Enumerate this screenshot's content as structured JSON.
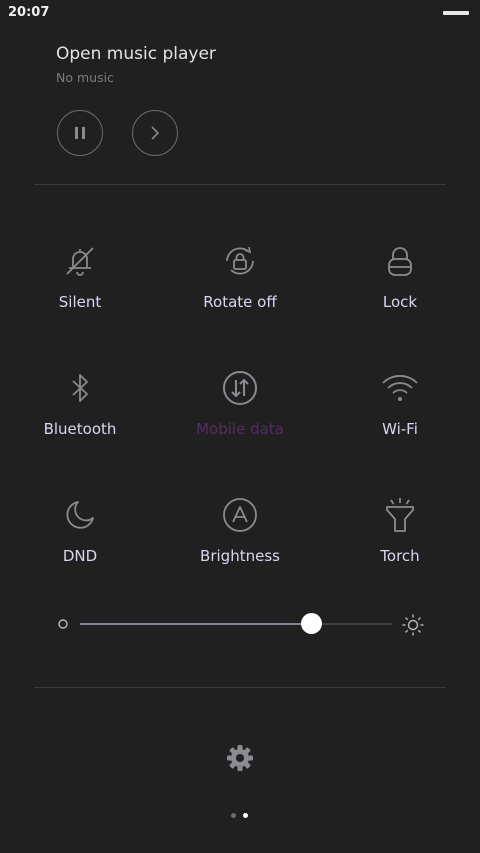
{
  "status_bar": {
    "time": "20:07"
  },
  "music": {
    "title": "Open music player",
    "subtitle": "No music",
    "controls": [
      {
        "name": "pause-button",
        "icon": "pause-icon"
      },
      {
        "name": "next-button",
        "icon": "chevron-right-icon"
      }
    ]
  },
  "toggles": [
    {
      "id": "silent",
      "label": "Silent",
      "icon": "bell-off-icon",
      "active": true
    },
    {
      "id": "rotate",
      "label": "Rotate off",
      "icon": "rotate-lock-icon",
      "active": true
    },
    {
      "id": "lock",
      "label": "Lock",
      "icon": "lock-icon",
      "active": true
    },
    {
      "id": "bluetooth",
      "label": "Bluetooth",
      "icon": "bluetooth-icon",
      "active": true
    },
    {
      "id": "mobile-data",
      "label": "Mobile data",
      "icon": "mobile-data-icon",
      "active": false
    },
    {
      "id": "wifi",
      "label": "Wi-Fi",
      "icon": "wifi-icon",
      "active": true
    },
    {
      "id": "dnd",
      "label": "DND",
      "icon": "moon-icon",
      "active": true
    },
    {
      "id": "brightness",
      "label": "Brightness",
      "icon": "auto-brightness-icon",
      "active": true
    },
    {
      "id": "torch",
      "label": "Torch",
      "icon": "flashlight-icon",
      "active": true
    }
  ],
  "brightness_slider": {
    "level": 0.74
  },
  "settings": {
    "icon": "gear-icon"
  },
  "pager": {
    "pages": 2,
    "current": 2
  },
  "colors": {
    "background": "#202021",
    "label_active": "#d9d6f2",
    "label_inactive": "#5a2a66",
    "icon": "#8a8a90"
  }
}
